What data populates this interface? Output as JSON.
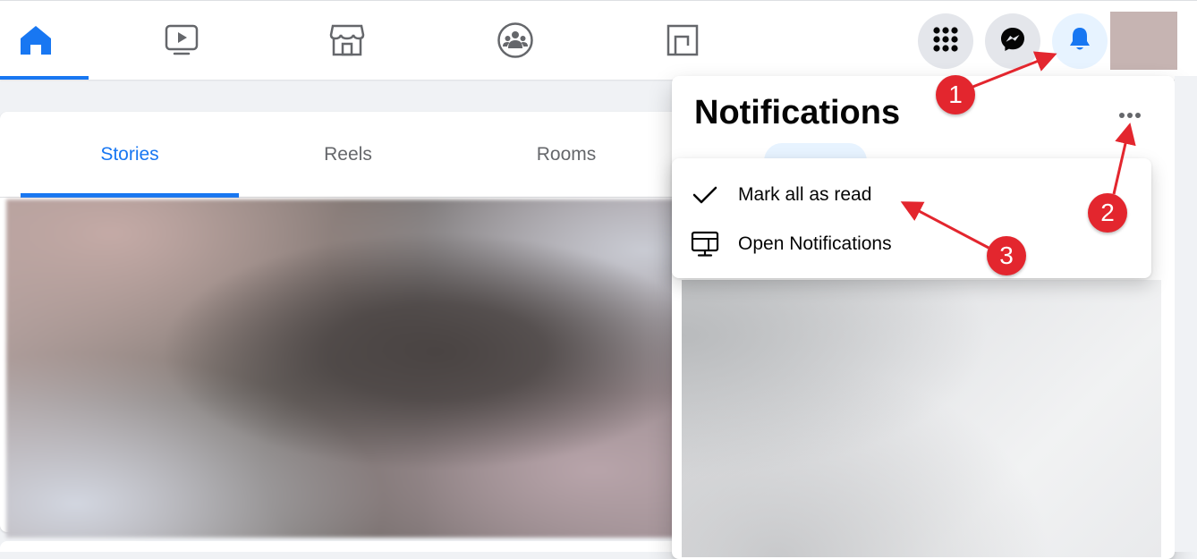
{
  "nav": {
    "tabs": [
      {
        "name": "home",
        "icon": "home-icon",
        "active": true
      },
      {
        "name": "watch",
        "icon": "video-icon",
        "active": false
      },
      {
        "name": "marketplace",
        "icon": "store-icon",
        "active": false
      },
      {
        "name": "groups",
        "icon": "groups-icon",
        "active": false
      },
      {
        "name": "gaming",
        "icon": "gaming-icon",
        "active": false
      }
    ],
    "right_buttons": [
      {
        "name": "menu",
        "icon": "grid-icon"
      },
      {
        "name": "messenger",
        "icon": "messenger-icon"
      },
      {
        "name": "notifications",
        "icon": "bell-icon",
        "active": true
      }
    ],
    "accent_color": "#1877f2"
  },
  "stories_card": {
    "tabs": [
      {
        "label": "Stories",
        "active": true
      },
      {
        "label": "Reels",
        "active": false
      },
      {
        "label": "Rooms",
        "active": false
      }
    ]
  },
  "notifications": {
    "title": "Notifications",
    "more_icon": "more-horizontal-icon",
    "menu": {
      "items": [
        {
          "label": "Mark all as read",
          "icon": "checkmark-icon"
        },
        {
          "label": "Open Notifications",
          "icon": "monitor-icon"
        }
      ]
    }
  },
  "annotations": {
    "color": "#e3262e",
    "steps": [
      "1",
      "2",
      "3"
    ]
  }
}
